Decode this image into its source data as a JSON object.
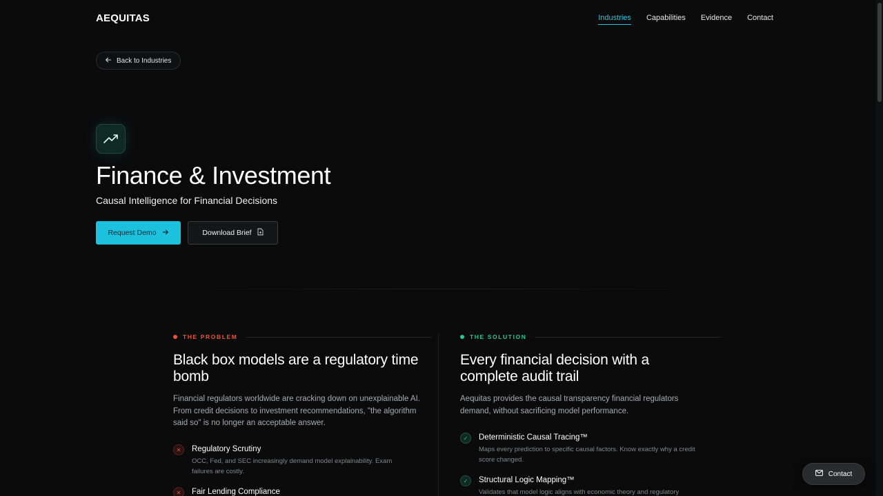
{
  "header": {
    "logo": "AEQUITAS",
    "nav": [
      {
        "label": "Industries",
        "active": true
      },
      {
        "label": "Capabilities",
        "active": false
      },
      {
        "label": "Evidence",
        "active": false
      },
      {
        "label": "Contact",
        "active": false
      }
    ]
  },
  "back_link": {
    "label": "Back to Industries",
    "icon": "arrow-left-icon"
  },
  "hero": {
    "icon": "trending-up-icon",
    "title": "Finance & Investment",
    "subtitle": "Causal Intelligence for Financial Decisions",
    "primary_button": "Request Demo",
    "secondary_button": "Download Brief"
  },
  "problem": {
    "eyebrow": "THE PROBLEM",
    "title": "Black box models are a regulatory time bomb",
    "body": "Financial regulators worldwide are cracking down on unexplainable AI. From credit decisions to investment recommendations, \"the algorithm said so\" is no longer an acceptable answer.",
    "items": [
      {
        "title": "Regulatory Scrutiny",
        "desc": "OCC, Fed, and SEC increasingly demand model explainability. Exam failures are costly."
      },
      {
        "title": "Fair Lending Compliance",
        "desc": ""
      }
    ]
  },
  "solution": {
    "eyebrow": "THE SOLUTION",
    "title": "Every financial decision with a complete audit trail",
    "body": "Aequitas provides the causal transparency financial regulators demand, without sacrificing model performance.",
    "items": [
      {
        "title": "Deterministic Causal Tracing™",
        "desc": "Maps every prediction to specific causal factors. Know exactly why a credit score changed."
      },
      {
        "title": "Structural Logic Mapping™",
        "desc": "Validates that model logic aligns with economic theory and regulatory"
      }
    ]
  },
  "contact_fab": {
    "label": "Contact",
    "icon": "mail-icon"
  },
  "colors": {
    "accent": "#1cc1de",
    "problem": "#f0533a",
    "solution": "#27c79a",
    "background": "#0b0b0c"
  }
}
